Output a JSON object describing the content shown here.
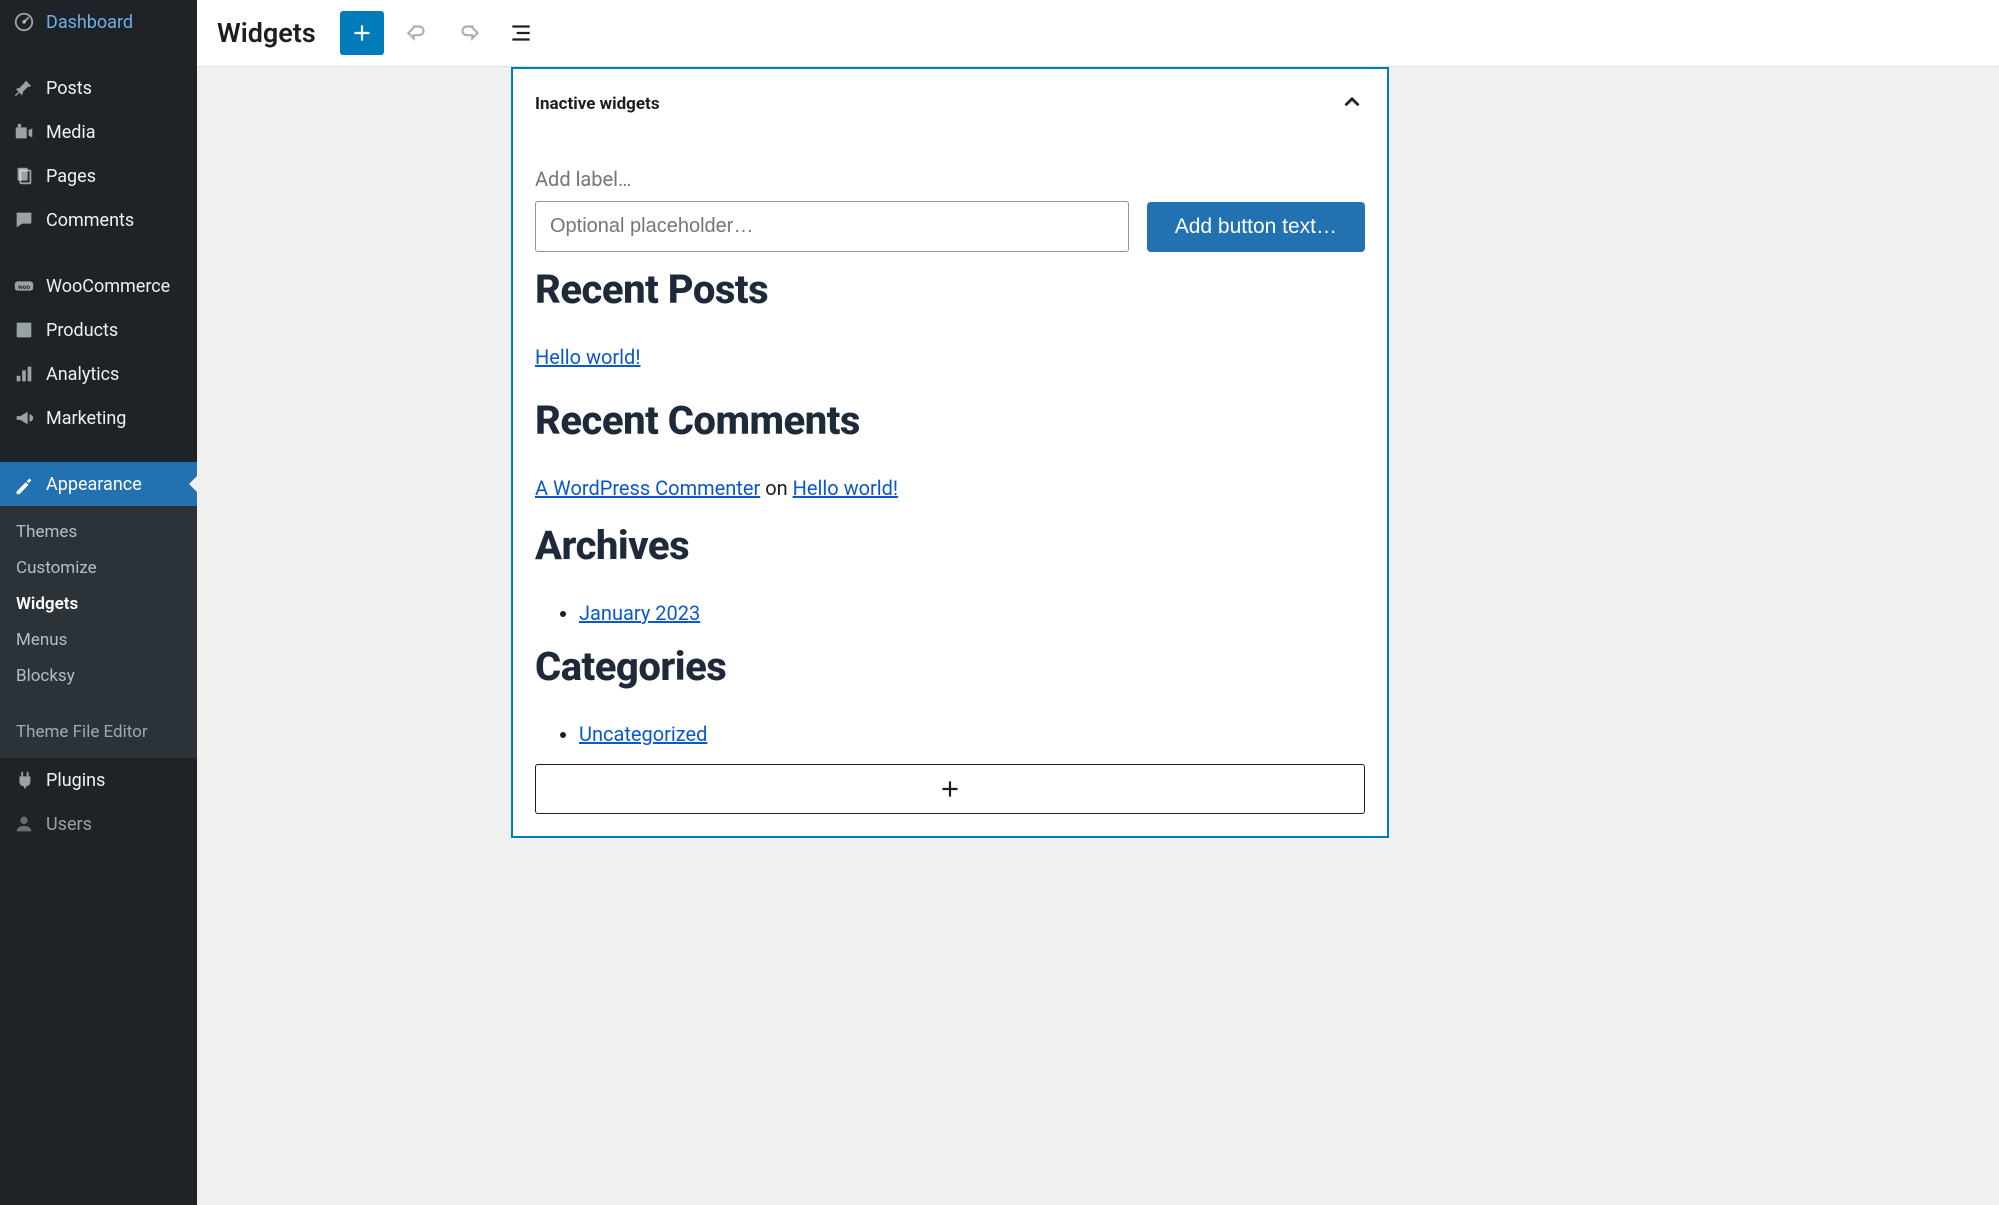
{
  "sidebar": {
    "dashboard": "Dashboard",
    "posts": "Posts",
    "media": "Media",
    "pages": "Pages",
    "comments": "Comments",
    "woo": "WooCommerce",
    "products": "Products",
    "analytics": "Analytics",
    "marketing": "Marketing",
    "appearance": "Appearance",
    "themes": "Themes",
    "customize": "Customize",
    "widgets": "Widgets",
    "menus": "Menus",
    "blocksy": "Blocksy",
    "theme_file_editor": "Theme File Editor",
    "plugins": "Plugins",
    "users": "Users"
  },
  "topbar": {
    "title": "Widgets"
  },
  "panel": {
    "title": "Inactive widgets",
    "add_label_placeholder": "Add label…",
    "input_placeholder": "Optional placeholder…",
    "button_text": "Add button text…"
  },
  "widgets": {
    "recent_posts_heading": "Recent Posts",
    "recent_post_1": "Hello world!",
    "recent_comments_heading": "Recent Comments",
    "commenter": "A WordPress Commenter",
    "on": " on ",
    "comment_post": "Hello world!",
    "archives_heading": "Archives",
    "archive_1": "January 2023",
    "categories_heading": "Categories",
    "category_1": "Uncategorized"
  }
}
